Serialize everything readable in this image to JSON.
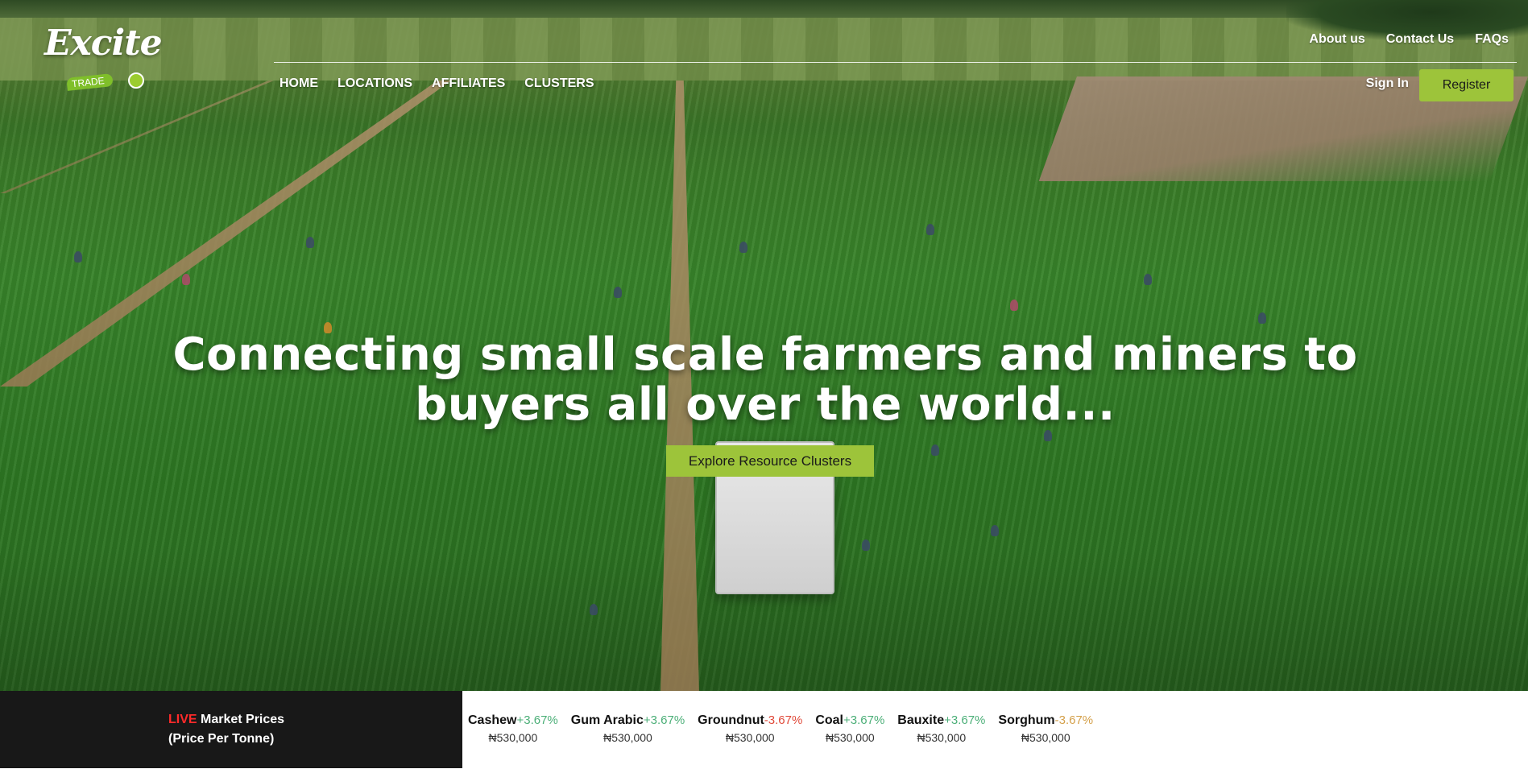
{
  "brand": {
    "logo_word": "Excite",
    "logo_tag": "TRADE"
  },
  "top_links": {
    "about": "About us",
    "contact": "Contact Us",
    "faqs": "FAQs"
  },
  "main_nav": {
    "home": "HOME",
    "locations": "LOCATIONS",
    "affiliates": "AFFILIATES",
    "clusters": "CLUSTERS"
  },
  "auth": {
    "signin": "Sign In",
    "register": "Register"
  },
  "hero": {
    "headline_line1": "Connecting small scale farmers and miners to",
    "headline_line2": "buyers all over the world...",
    "cta": "Explore Resource Clusters"
  },
  "ticker": {
    "live": "LIVE",
    "label_rest": " Market Prices",
    "label_sub": "(Price Per Tonne)",
    "items": [
      {
        "name": "Cashew",
        "change": "+3.67%",
        "price": "₦530,000",
        "trend": "up"
      },
      {
        "name": "Gum Arabic",
        "change": "+3.67%",
        "price": "₦530,000",
        "trend": "up"
      },
      {
        "name": "Groundnut",
        "change": "-3.67%",
        "price": "₦530,000",
        "trend": "down-red"
      },
      {
        "name": "Coal",
        "change": "+3.67%",
        "price": "₦530,000",
        "trend": "up"
      },
      {
        "name": "Bauxite",
        "change": "+3.67%",
        "price": "₦530,000",
        "trend": "up"
      },
      {
        "name": "Sorghum",
        "change": "-3.67%",
        "price": "₦530,000",
        "trend": "down-amber"
      }
    ]
  },
  "colors": {
    "accent": "#9dc43a",
    "live_red": "#ff2a2a",
    "ticker_dark": "#181818",
    "up_green": "#4caf78"
  }
}
